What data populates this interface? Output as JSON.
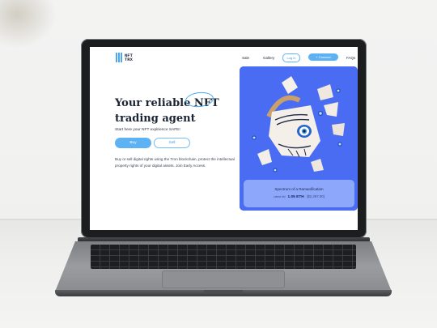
{
  "site": {
    "logo": {
      "line1": "NFT",
      "line2": "TRX"
    },
    "nav": {
      "sale": "Sale",
      "gallery": "Gallery",
      "login": "Log in",
      "connect": "+ Connect",
      "faqs": "FAQs"
    }
  },
  "hero": {
    "title_part1": "Your reliable ",
    "title_highlight": "NFT",
    "title_part2": "trading agent",
    "tagline": "Start here your NFT explrience SAFE!",
    "buy_label": "Buy",
    "sell_label": "Sell",
    "description": "Buy or sell digital rights using the Tron blockchain, protect the intellectual property rights of your digital assets. Join Early Access."
  },
  "nft": {
    "name": "Spectrum of a Ramanification",
    "bid_label": "Latest bid",
    "price_eth": "1.05 ETH",
    "price_usd": "($2,297.00)"
  },
  "colors": {
    "accent": "#5cb2f2",
    "card_bg": "#4a6cf3",
    "title_text": "#1b2433"
  }
}
